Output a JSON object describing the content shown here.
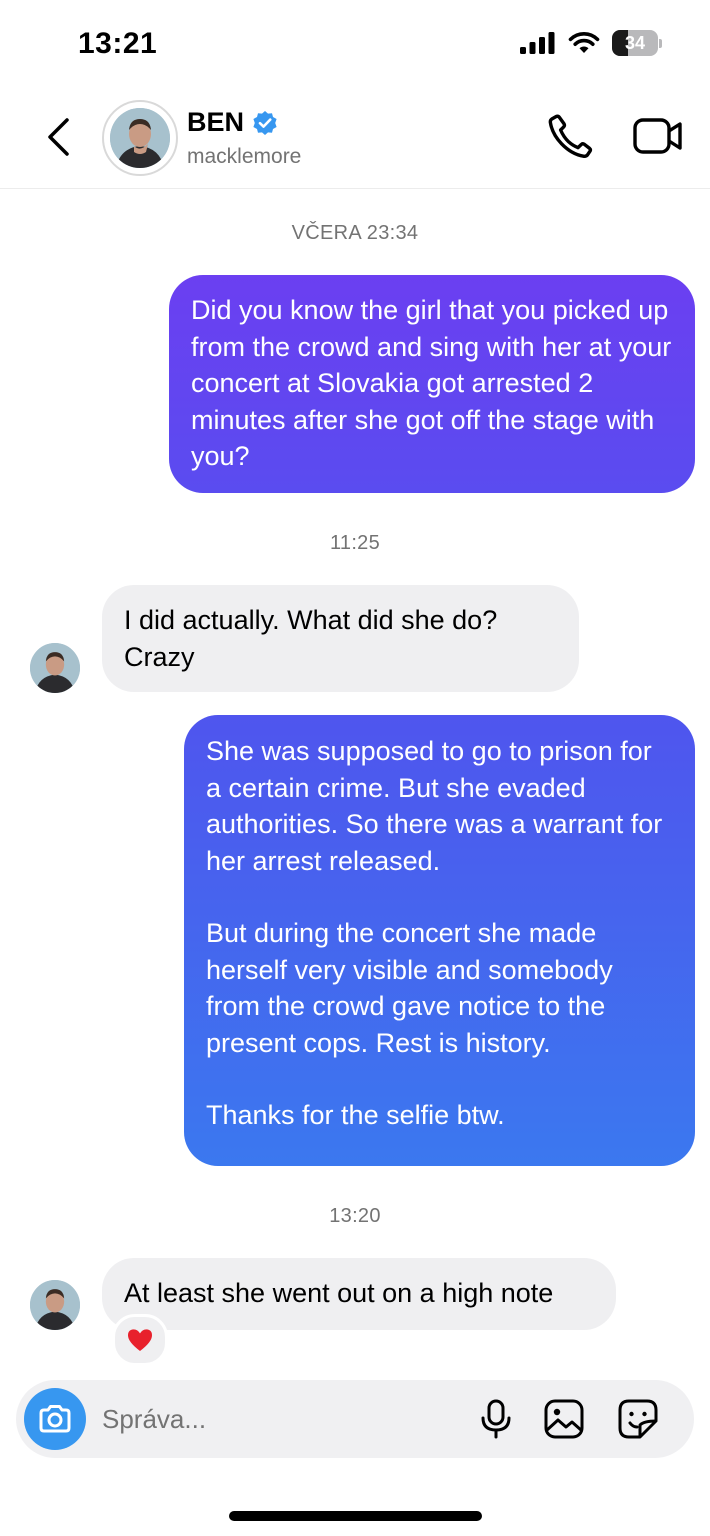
{
  "status_bar": {
    "time": "13:21",
    "battery": "34"
  },
  "header": {
    "name": "BEN",
    "username": "macklemore"
  },
  "timestamps": {
    "t1": "VČERA 23:34",
    "t2": "11:25",
    "t3": "13:20"
  },
  "messages": [
    {
      "direction": "outgoing",
      "paragraphs": [
        "Did you know the girl that you picked up from the crowd and sing with her at your concert at Slovakia got arrested 2 minutes after she got off the stage with you?"
      ]
    },
    {
      "direction": "incoming",
      "paragraphs": [
        "I did actually.  What did she do? Crazy"
      ]
    },
    {
      "direction": "outgoing",
      "paragraphs": [
        "She was supposed to go to prison for a certain crime. But she evaded authorities. So there was a warrant for her arrest released.",
        "But during the concert she made herself very visible and somebody from the crowd gave notice to the present cops. Rest is history.",
        "Thanks for the selfie btw."
      ]
    },
    {
      "direction": "incoming",
      "paragraphs": [
        "At least she went out on a high note"
      ],
      "reaction": "❤️"
    }
  ],
  "composer": {
    "placeholder": "Správa..."
  },
  "icons": {
    "back": "chevron-left-icon",
    "verified": "verified-badge-icon",
    "call": "phone-icon",
    "video": "video-camera-icon",
    "camera": "camera-icon",
    "mic": "microphone-icon",
    "gallery": "image-icon",
    "sticker": "sticker-icon"
  },
  "colors": {
    "bubble_gradient_top": "#6a3ff0",
    "bubble_gradient_bottom": "#3b7bf0",
    "incoming_bubble": "#efeff1",
    "verified_blue": "#3797f0",
    "camera_button": "#3797f0"
  }
}
